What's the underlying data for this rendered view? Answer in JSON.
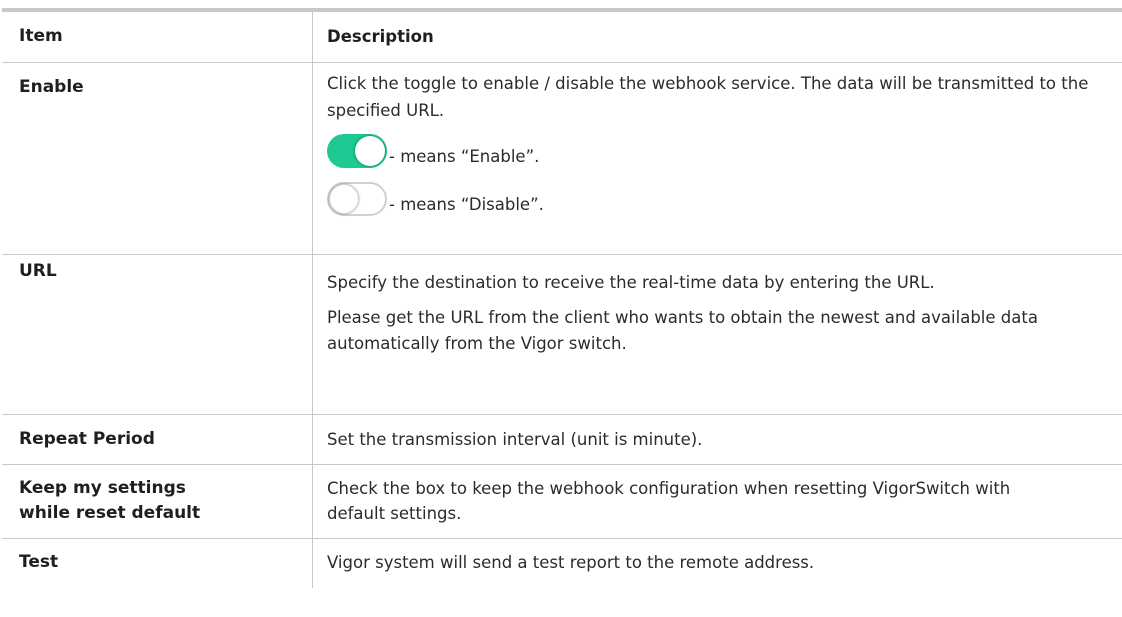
{
  "header": {
    "item": "Item",
    "description": "Description"
  },
  "rows": [
    {
      "item": "Enable",
      "desc": "Click the toggle to enable / disable the webhook service. The data will be transmitted to the specified URL.",
      "toggles": [
        {
          "state": "on",
          "text": "- means “Enable”."
        },
        {
          "state": "off",
          "text": "- means “Disable”."
        }
      ]
    },
    {
      "item": "URL",
      "desc": "Specify the destination to receive the real-time data by entering the URL.",
      "desc2": "Please get the URL from the client who wants to obtain the newest and available data automatically from the Vigor switch."
    },
    {
      "item": "Repeat Period",
      "desc": "Set the transmission interval (unit is minute)."
    },
    {
      "item_line1": "Keep my settings",
      "item_line2": "while reset default",
      "desc": "Check the box to keep the webhook configuration when resetting VigorSwitch with default settings."
    },
    {
      "item": "Test",
      "desc": "Vigor system will send a test report to the remote address."
    }
  ],
  "colors": {
    "toggle_on": "#1ec994",
    "rule": "#c8c8c8"
  }
}
